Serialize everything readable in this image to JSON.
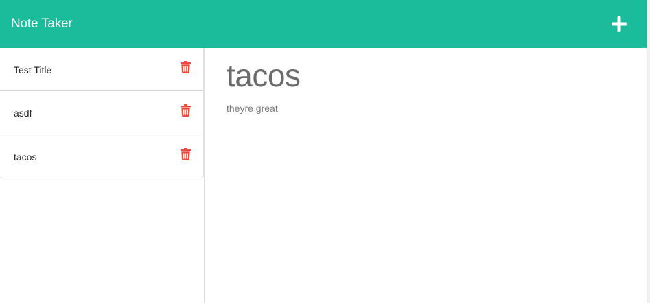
{
  "navbar": {
    "brand": "Note Taker",
    "new_note_icon": "plus-icon",
    "bg_color": "#1abc9c"
  },
  "notes": [
    {
      "title": "Test Title",
      "delete_icon": "trash-icon"
    },
    {
      "title": "asdf",
      "delete_icon": "trash-icon"
    },
    {
      "title": "tacos",
      "delete_icon": "trash-icon"
    }
  ],
  "active_note": {
    "title": "tacos",
    "text": "theyre great"
  },
  "colors": {
    "accent": "#1abc9c",
    "delete": "#e74c3c"
  }
}
